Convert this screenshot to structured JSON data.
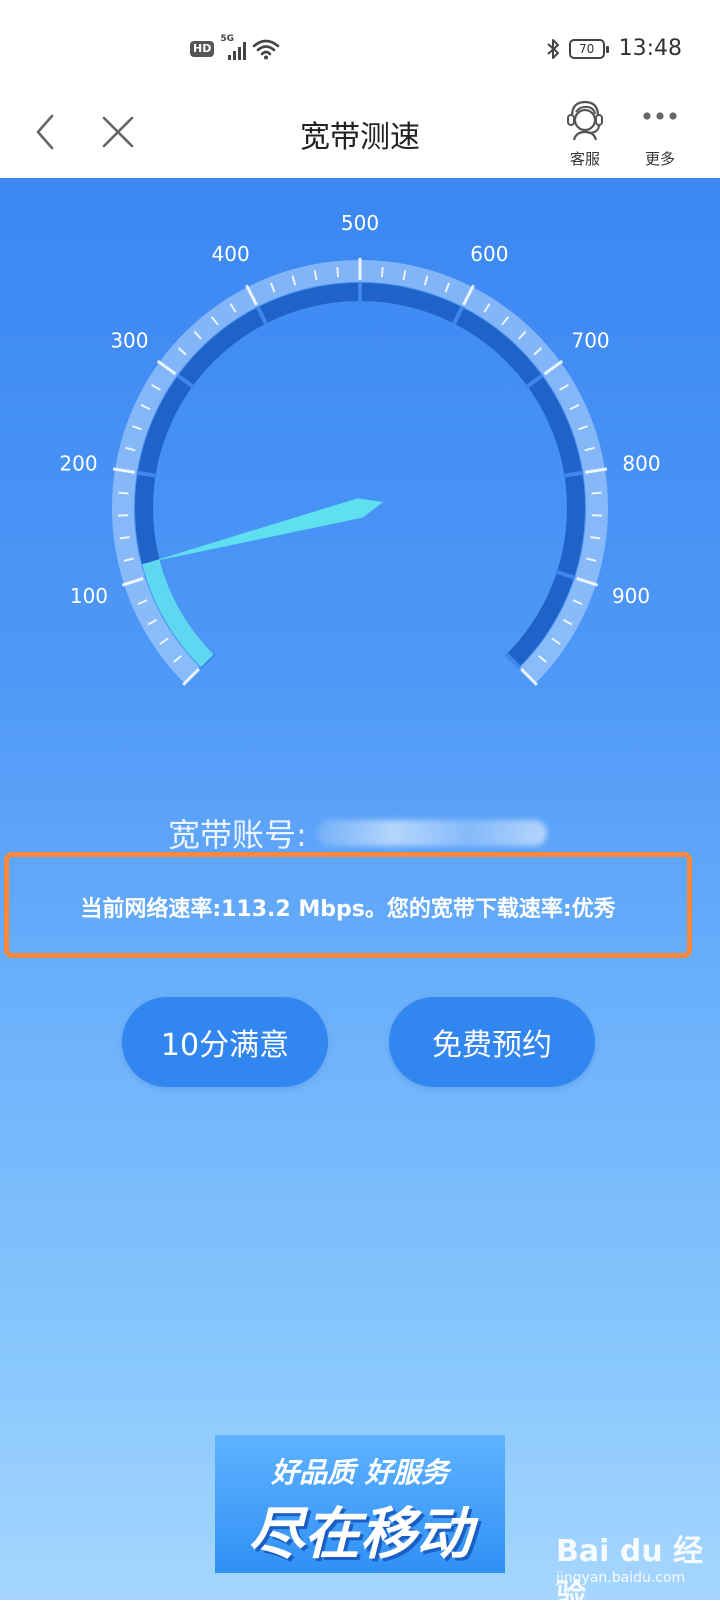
{
  "status_bar": {
    "network_badge": "HD",
    "network_type": "5G",
    "battery": "70",
    "time": "13:48",
    "icons": [
      "signal-icon",
      "wifi-icon",
      "bluetooth-icon",
      "battery-icon"
    ]
  },
  "nav": {
    "title": "宽带测速",
    "customer_service_label": "客服",
    "more_label": "更多",
    "icons": [
      "back-icon",
      "close-icon",
      "customer-service-icon",
      "more-icon"
    ]
  },
  "gauge": {
    "min": 0,
    "max": 1000,
    "ticks": [
      "0",
      "100",
      "200",
      "300",
      "400",
      "500",
      "600",
      "700",
      "800",
      "900",
      "1000"
    ],
    "current_value": 113.2
  },
  "account": {
    "label": "宽带账号:"
  },
  "result": {
    "text": "当前网络速率:113.2 Mbps。您的宽带下载速率:优秀"
  },
  "buttons": {
    "rate": "10分满意",
    "book": "免费预约"
  },
  "banner": {
    "line1": "好品质 好服务",
    "line2": "尽在移动"
  },
  "watermark": {
    "brand": "Bai du 经验",
    "url": "jingyan.baidu.com"
  },
  "colors": {
    "accent_blue": "#3b87f2",
    "button_blue": "#3286ef",
    "highlight_orange": "#f7893e",
    "needle_cyan": "#5ee0f0"
  }
}
